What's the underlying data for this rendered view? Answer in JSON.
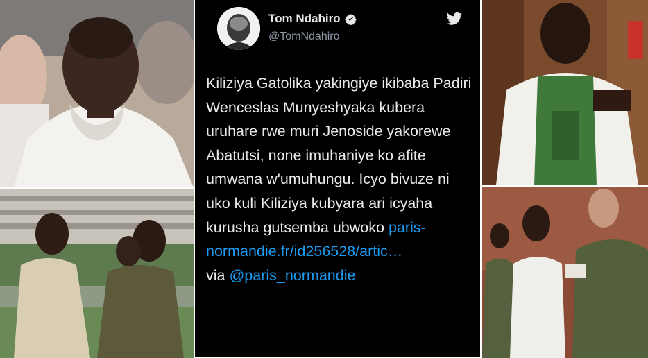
{
  "tweet": {
    "author_name": "Tom Ndahiro",
    "author_handle": "@TomNdahiro",
    "verified_icon": "verified-badge-icon",
    "brand_icon": "twitter-bird-icon",
    "body_text": "Kiliziya Gatolika yakingiye ikibaba Padiri Wenceslas Munyeshyaka kubera uruhare rwe muri Jenoside yakorewe Abatutsi, none imuhaniye ko afite umwana w'umuhungu. Icyo bivuze ni uko kuli Kiliziya kubyara ari icyaha kurusha gutsemba ubwoko ",
    "link_text": "paris-normandie.fr/id256528/artic…",
    "via_label": "via ",
    "mention_text": "@paris_normandie"
  },
  "colors": {
    "tweet_background": "#000000",
    "text": "#e7e9ea",
    "link": "#1d9bf0",
    "handle": "#8b98a5"
  },
  "photos": [
    "priest-in-white-vestment-photo",
    "man-with-soldier-outdoors-photo",
    "priest-in-green-vestment-preaching-photo",
    "man-escorted-by-soldiers-photo"
  ]
}
